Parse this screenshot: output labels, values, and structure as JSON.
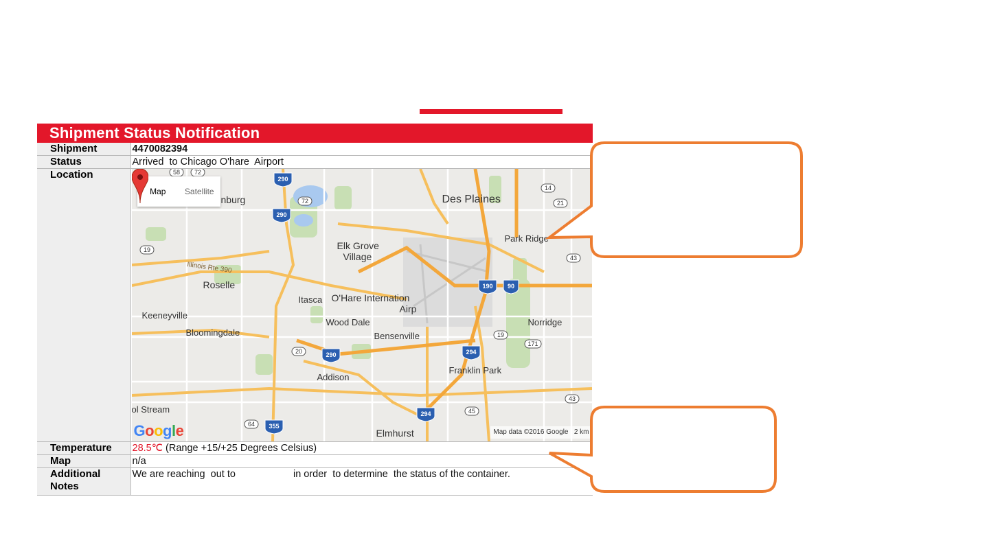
{
  "notification": {
    "title": "Shipment Status Notification",
    "rows": {
      "shipment": {
        "label": "Shipment",
        "value": "4470082394"
      },
      "status": {
        "label": "Status",
        "value": "Arrived  to Chicago O'hare  Airport"
      },
      "location": {
        "label": "Location"
      },
      "temperature": {
        "label": "Temperature",
        "reading": "28.5℃",
        "range": " (Range +15/+25 Degrees Celsius)"
      },
      "map": {
        "label": "Map",
        "value": "n/a"
      },
      "notes": {
        "label_line1": "Additional",
        "label_line2": "Notes",
        "value_part1": "We are reaching  out to",
        "value_part2": "in order  to determine  the status of the container."
      }
    }
  },
  "map": {
    "toggle": {
      "map": "Map",
      "satellite": "Satellite"
    },
    "places": {
      "des_plaines": "Des Plaines",
      "park_ridge": "Park Ridge",
      "elk_grove": "Elk Grove",
      "village": "Village",
      "roselle": "Roselle",
      "itasca": "Itasca",
      "ohare": "O'Hare Internation",
      "airport": "Airp",
      "keeneyville": "Keeneyville",
      "wood_dale": "Wood Dale",
      "norridge": "Norridge",
      "bloomingdale": "Bloomingdale",
      "bensenville": "Bensenville",
      "franklin_park": "Franklin Park",
      "addison": "Addison",
      "carol_stream": "ol Stream",
      "elmhurst": "Elmhurst",
      "burg": "nburg",
      "il_rte": "Illinois Rte 390"
    },
    "shields": [
      "290",
      "290",
      "290",
      "190",
      "90",
      "294",
      "294",
      "355"
    ],
    "state_routes": [
      "58",
      "72",
      "19",
      "14",
      "21",
      "43",
      "19",
      "171",
      "20",
      "45",
      "43",
      "64"
    ],
    "attribution": "Map data ©2016 Google   2 km",
    "google": [
      "G",
      "o",
      "o",
      "g",
      "l",
      "e"
    ]
  },
  "colors": {
    "brand_red": "#e3172a",
    "callout_orange": "#ed7d31"
  }
}
